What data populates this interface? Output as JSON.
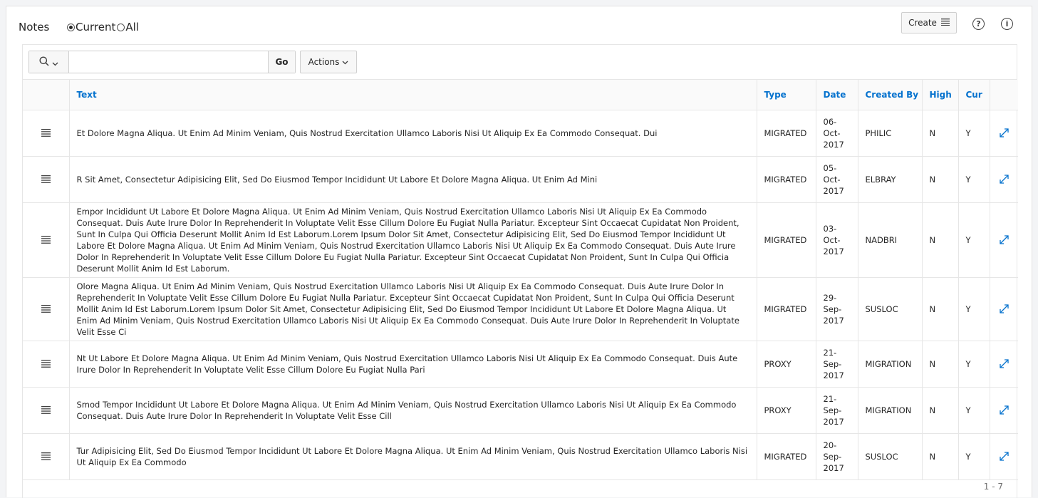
{
  "region": {
    "title": "Notes",
    "filter_options": [
      {
        "label": "Current",
        "checked": true
      },
      {
        "label": "All",
        "checked": false
      }
    ],
    "create_label": "Create",
    "help_icon": "?",
    "info_icon": "i"
  },
  "toolbar": {
    "search_value": "",
    "go_label": "Go",
    "actions_label": "Actions"
  },
  "table": {
    "columns": [
      "",
      "Text",
      "Type",
      "Date",
      "Created By",
      "High",
      "Cur",
      ""
    ],
    "rows": [
      {
        "text": "Et Dolore Magna Aliqua. Ut Enim Ad Minim Veniam, Quis Nostrud Exercitation Ullamco Laboris Nisi Ut Aliquip Ex Ea Commodo Consequat. Dui",
        "type": "MIGRATED",
        "date": "06-Oct-2017",
        "created_by": "PHILIC",
        "high": "N",
        "cur": "Y"
      },
      {
        "text": "R Sit Amet, Consectetur Adipisicing Elit, Sed Do Eiusmod Tempor Incididunt Ut Labore Et Dolore Magna Aliqua. Ut Enim Ad Mini",
        "type": "MIGRATED",
        "date": "05-Oct-2017",
        "created_by": "ELBRAY",
        "high": "N",
        "cur": "Y"
      },
      {
        "text": "Empor Incididunt Ut Labore Et Dolore Magna Aliqua. Ut Enim Ad Minim Veniam, Quis Nostrud Exercitation Ullamco Laboris Nisi Ut Aliquip Ex Ea Commodo Consequat. Duis Aute Irure Dolor In Reprehenderit In Voluptate Velit Esse Cillum Dolore Eu Fugiat Nulla Pariatur. Excepteur Sint Occaecat Cupidatat Non Proident, Sunt In Culpa Qui Officia Deserunt Mollit Anim Id Est Laborum.Lorem Ipsum Dolor Sit Amet, Consectetur Adipisicing Elit, Sed Do Eiusmod Tempor Incididunt Ut Labore Et Dolore Magna Aliqua. Ut Enim Ad Minim Veniam, Quis Nostrud Exercitation Ullamco Laboris Nisi Ut Aliquip Ex Ea Commodo Consequat. Duis Aute Irure Dolor In Reprehenderit In Voluptate Velit Esse Cillum Dolore Eu Fugiat Nulla Pariatur. Excepteur Sint Occaecat Cupidatat Non Proident, Sunt In Culpa Qui Officia Deserunt Mollit Anim Id Est Laborum.",
        "type": "MIGRATED",
        "date": "03-Oct-2017",
        "created_by": "NADBRI",
        "high": "N",
        "cur": "Y"
      },
      {
        "text": "Olore Magna Aliqua. Ut Enim Ad Minim Veniam, Quis Nostrud Exercitation Ullamco Laboris Nisi Ut Aliquip Ex Ea Commodo Consequat. Duis Aute Irure Dolor In Reprehenderit In Voluptate Velit Esse Cillum Dolore Eu Fugiat Nulla Pariatur. Excepteur Sint Occaecat Cupidatat Non Proident, Sunt In Culpa Qui Officia Deserunt Mollit Anim Id Est Laborum.Lorem Ipsum Dolor Sit Amet, Consectetur Adipisicing Elit, Sed Do Eiusmod Tempor Incididunt Ut Labore Et Dolore Magna Aliqua. Ut Enim Ad Minim Veniam, Quis Nostrud Exercitation Ullamco Laboris Nisi Ut Aliquip Ex Ea Commodo Consequat. Duis Aute Irure Dolor In Reprehenderit In Voluptate Velit Esse Ci",
        "type": "MIGRATED",
        "date": "29-Sep-2017",
        "created_by": "SUSLOC",
        "high": "N",
        "cur": "Y"
      },
      {
        "text": "Nt Ut Labore Et Dolore Magna Aliqua. Ut Enim Ad Minim Veniam, Quis Nostrud Exercitation Ullamco Laboris Nisi Ut Aliquip Ex Ea Commodo Consequat. Duis Aute Irure Dolor In Reprehenderit In Voluptate Velit Esse Cillum Dolore Eu Fugiat Nulla Pari",
        "type": "PROXY",
        "date": "21-Sep-2017",
        "created_by": "MIGRATION",
        "high": "N",
        "cur": "Y"
      },
      {
        "text": "Smod Tempor Incididunt Ut Labore Et Dolore Magna Aliqua. Ut Enim Ad Minim Veniam, Quis Nostrud Exercitation Ullamco Laboris Nisi Ut Aliquip Ex Ea Commodo Consequat. Duis Aute Irure Dolor In Reprehenderit In Voluptate Velit Esse Cill",
        "type": "PROXY",
        "date": "21-Sep-2017",
        "created_by": "MIGRATION",
        "high": "N",
        "cur": "Y"
      },
      {
        "text": "Tur Adipisicing Elit, Sed Do Eiusmod Tempor Incididunt Ut Labore Et Dolore Magna Aliqua. Ut Enim Ad Minim Veniam, Quis Nostrud Exercitation Ullamco Laboris Nisi Ut Aliquip Ex Ea Commodo",
        "type": "MIGRATED",
        "date": "20-Sep-2017",
        "created_by": "SUSLOC",
        "high": "N",
        "cur": "Y"
      }
    ]
  },
  "pagination": {
    "range": "1 - 7"
  },
  "icons": {
    "search": "search-icon",
    "row_menu": "hamburger-menu-icon",
    "expand": "expand-arrows-icon"
  },
  "colors": {
    "header_link": "#0572ce",
    "text": "#262626"
  }
}
